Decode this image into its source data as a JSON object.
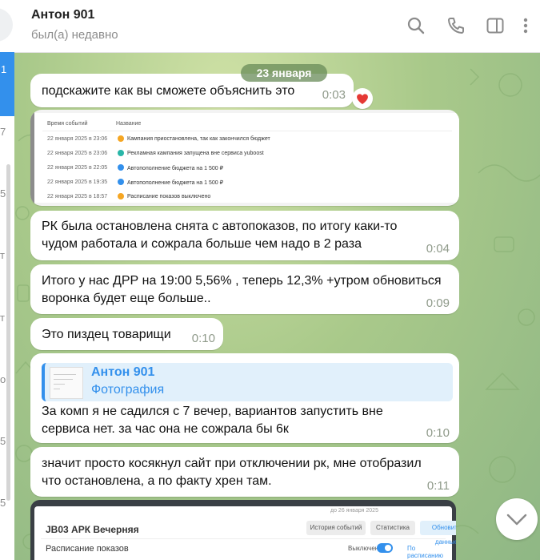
{
  "header": {
    "title": "Антон 901",
    "status": "был(а) недавно",
    "icons": [
      "search-icon",
      "phone-icon",
      "sidebar-toggle-icon",
      "more-icon"
    ]
  },
  "left_strip": {
    "chars": [
      "1",
      "7",
      "5",
      "т",
      "т",
      "о",
      "5",
      "5"
    ]
  },
  "date_pill": "23 января",
  "messages": [
    {
      "text": "подскажите как вы сможете объяснить это",
      "time": "0:03",
      "reaction": "heart"
    },
    {
      "text_lines": [
        "РК была остановлена снята с автопоказов, по итогу каки-то",
        "чудом работала и сожрала больше чем надо в 2 раза"
      ],
      "time": "0:04"
    },
    {
      "text_lines": [
        "Итого у нас ДРР на 19:00 5,56% , теперь 12,3% +утром обновиться",
        "воронка будет еще больше.."
      ],
      "time": "0:09"
    },
    {
      "text": "Это пиздец товарищи",
      "time": "0:10"
    },
    {
      "reply": {
        "name": "Антон 901",
        "kind": "Фотография"
      },
      "text_lines": [
        "За комп я не садился с 7 вечер, вариантов запустить вне",
        "сервиса нет. за час она не сожрала бы 6к"
      ],
      "time": "0:10"
    },
    {
      "text_lines": [
        "значит просто косякнул сайт при отключении рк, мне отобразил",
        "что остановлена, а по факту хрен там."
      ],
      "time": "0:11"
    }
  ],
  "screenshot_table": {
    "headers": [
      "Время событий",
      "Название"
    ],
    "rows": [
      {
        "date": "22 января 2025 в 23:06",
        "name": "Кампания приостановлена, так как закончился бюджет",
        "color": "#f5a623"
      },
      {
        "date": "22 января 2025 в 23:06",
        "name": "Рекламная кампания запущена вне сервиса yuboost",
        "color": "#29b6a8"
      },
      {
        "date": "22 января 2025 в 22:05",
        "name": "Автопополнение бюджета на 1 500 ₽",
        "color": "#3390ec"
      },
      {
        "date": "22 января 2025 в 19:35",
        "name": "Автопополнение бюджета на 1 500 ₽",
        "color": "#3390ec"
      },
      {
        "date": "22 января 2025 в 18:57",
        "name": "Расписание показов выключено",
        "color": "#f5a623"
      }
    ]
  },
  "bottom_card": {
    "title": "JB03 АРК Вечерняя",
    "subtitle": "Расписание показов",
    "top_note": "до 26 января 2025",
    "buttons": [
      "История событий",
      "Статистика",
      "Обновить данные"
    ],
    "toggle_off": "Выключено",
    "toggle_on": "По расписанию"
  },
  "colors": {
    "accent": "#3390ec",
    "reaction": "#e53935"
  }
}
